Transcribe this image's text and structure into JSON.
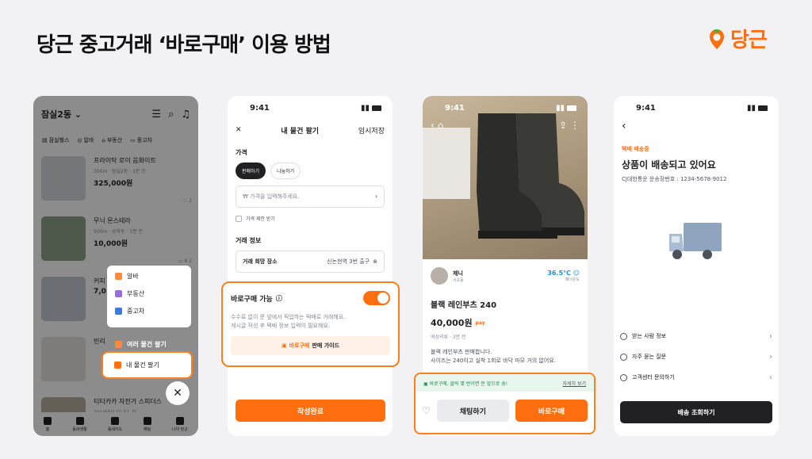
{
  "title": "당근 중고거래 ‘바로구매’ 이용 방법",
  "brand": {
    "word": "당근",
    "color": "#ff6f0f"
  },
  "screen1": {
    "location": "잠실2동",
    "chips": [
      "잠실웰스",
      "알바",
      "부동산",
      "중고차"
    ],
    "listings": [
      {
        "title": "프라이탁 로이 음화이트",
        "meta": "300m · 잠실2동 · 1분 전",
        "price": "325,000원",
        "stats": "2"
      },
      {
        "title": "무늬 몬스테라",
        "meta": "500m · 송파동 · 3분 전",
        "price": "10,000원",
        "stats": "6  2"
      },
      {
        "title": "커피",
        "meta": "",
        "price": "7,0",
        "stats": ""
      },
      {
        "title": "빈리",
        "meta": "",
        "price": "",
        "stats": ""
      },
      {
        "title": "티티카카 자전거 스피더스",
        "meta": "2019년식 입니다. 타...",
        "price": "",
        "stats": ""
      }
    ],
    "menu": [
      "알바",
      "부동산",
      "중고차"
    ],
    "multi_sell": "여러 물건 팔기",
    "sell": "내 물건 팔기",
    "tabs": [
      "홈",
      "동네생활",
      "동네지도",
      "채팅",
      "나의 당근"
    ]
  },
  "screen2": {
    "time": "9:41",
    "header_title": "내 물건 팔기",
    "save_draft": "임시저장",
    "price_label": "가격",
    "pill_sell": "판매하기",
    "pill_share": "나눔하기",
    "price_placeholder": "₩ 가격을 입력해주세요.",
    "offer_check": "가격 제안 받기",
    "deal_label": "거래 정보",
    "place_label": "거래 희망 장소",
    "place_value": "신논현역 3번 출구",
    "baro_title": "바로구매 가능",
    "baro_desc1": "수수료 없이 문 앞에서 픽업하는 택배로 거래해요.",
    "baro_desc2": "게시글 작성 후 택배 정보 입력이 필요해요.",
    "guide_prefix": "바로구매",
    "guide_suffix": "판매 가이드",
    "submit": "작성완료"
  },
  "screen3": {
    "time": "9:41",
    "seller_name": "제니",
    "seller_loc": "서초동",
    "temp": "36.5°C",
    "temp_label": "매너온도",
    "title": "블랙 레인부츠 240",
    "price": "40,000원",
    "pay": "pay",
    "meta": "여성의류 · 3분 전",
    "desc1": "블랙 레인부츠 판매합니다.",
    "desc2": "사이즈는 240이고 실착 1회로 바닥 마모 거의 없어요.",
    "notice": "바로구매, 클릭 몇 번이면 문 앞으로 슝!",
    "notice_more": "자세히 보기",
    "chat": "채팅하기",
    "buy": "바로구매"
  },
  "screen4": {
    "time": "9:41",
    "status": "택배 배송중",
    "title": "상품이 배송되고 있어요",
    "tracking": "CJ대한통운 운송장번호 : 1234-5678-9012",
    "rows": [
      "받는 사람 정보",
      "자주 묻는 질문",
      "고객센터 문의하기"
    ],
    "button": "배송 조회하기"
  }
}
